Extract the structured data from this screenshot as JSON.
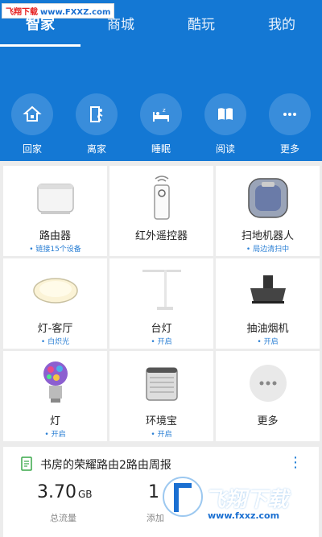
{
  "watermark_top": {
    "part1": "飞翔下载",
    "part2": "www.FXXZ.com"
  },
  "tabs": [
    {
      "label": "智家",
      "active": true
    },
    {
      "label": "商城",
      "active": false
    },
    {
      "label": "酷玩",
      "active": false
    },
    {
      "label": "我的",
      "active": false
    }
  ],
  "scenes": [
    {
      "label": "回家",
      "icon": "home-icon"
    },
    {
      "label": "离家",
      "icon": "leave-home-icon"
    },
    {
      "label": "睡眠",
      "icon": "sleep-icon"
    },
    {
      "label": "阅读",
      "icon": "book-icon"
    },
    {
      "label": "更多",
      "icon": "more-icon"
    }
  ],
  "devices": [
    {
      "name": "路由器",
      "status": "链接15个设备"
    },
    {
      "name": "红外遥控器",
      "status": ""
    },
    {
      "name": "扫地机器人",
      "status": "局边清扫中"
    },
    {
      "name": "灯-客厅",
      "status": "白炽光"
    },
    {
      "name": "台灯",
      "status": "开启"
    },
    {
      "name": "抽油烟机",
      "status": "开启"
    },
    {
      "name": "灯",
      "status": "开启"
    },
    {
      "name": "环境宝",
      "status": "开启"
    },
    {
      "name": "更多",
      "status": ""
    }
  ],
  "report": {
    "title": "书房的荣耀路由2路由周报",
    "stat1_value": "3.70",
    "stat1_unit": "GB",
    "stat1_label": "总流量",
    "stat2_value": "1",
    "stat2_label": "添加"
  },
  "watermark_bottom": {
    "text": "飞翔下载",
    "url": "www.fxxz.com"
  },
  "colors": {
    "primary": "#1478d4",
    "status": "#2a7fd4",
    "background": "#ececec"
  }
}
